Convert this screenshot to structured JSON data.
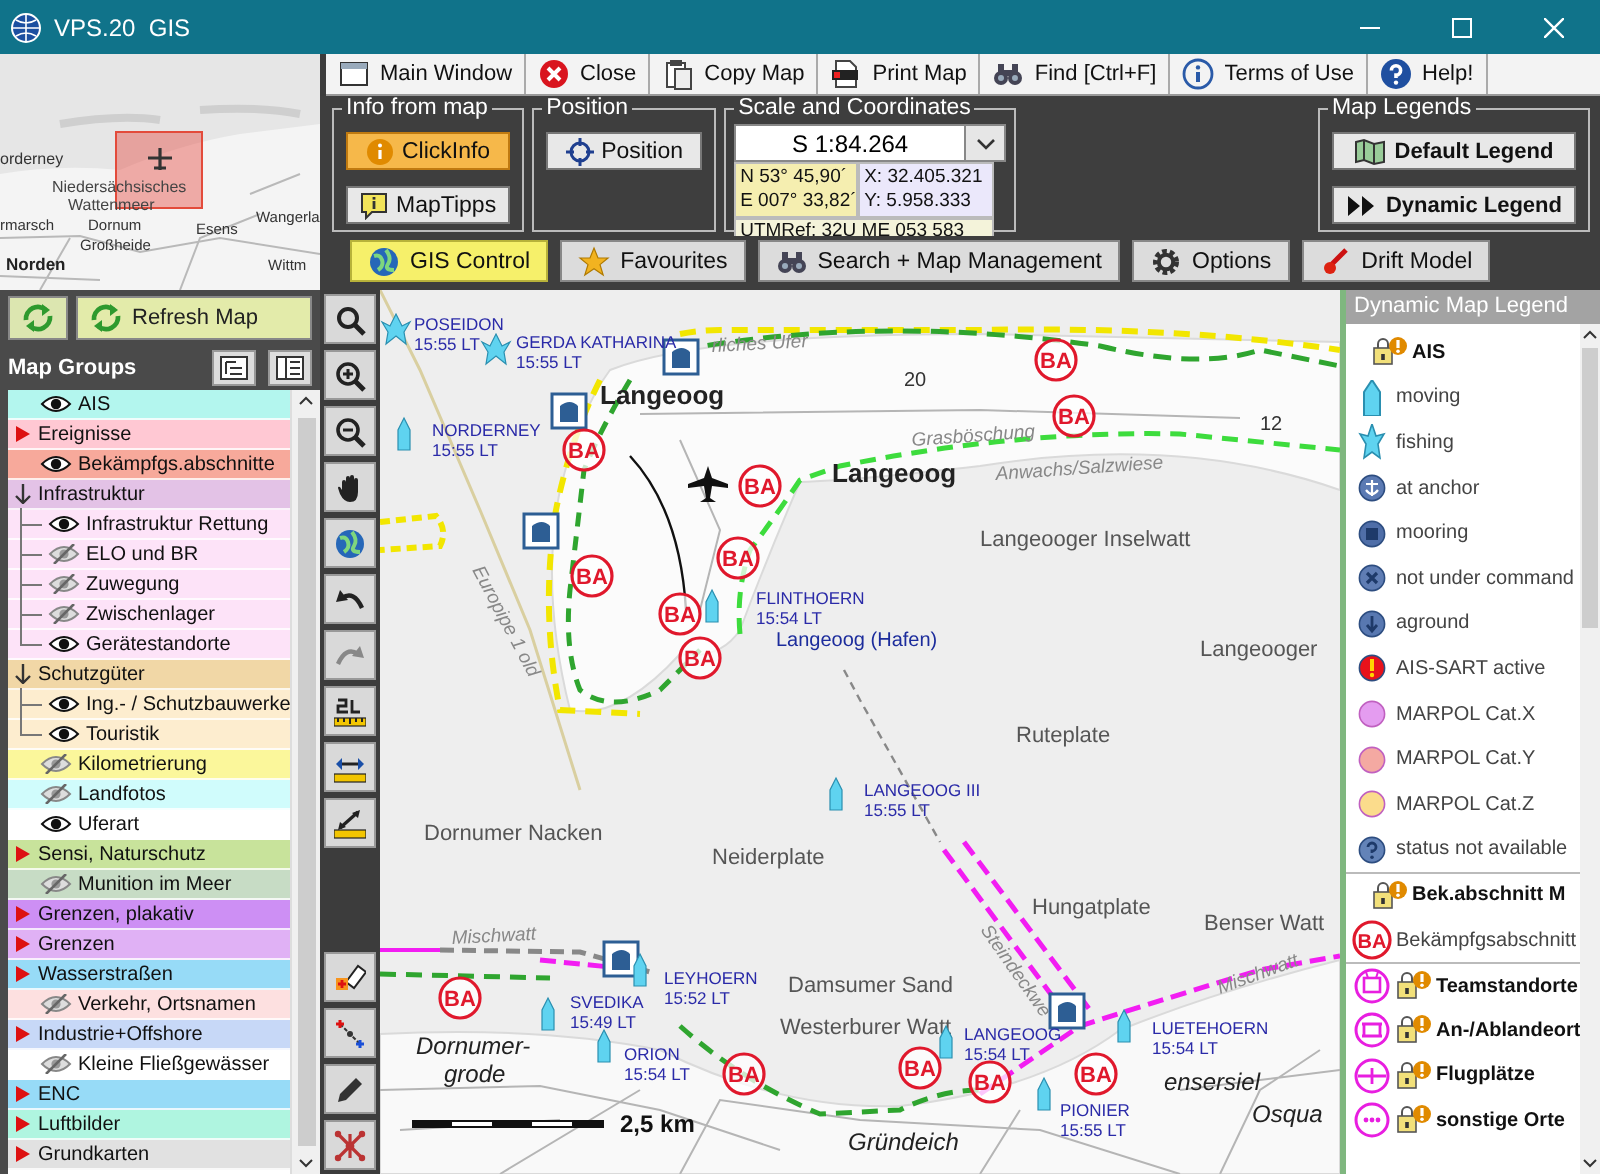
{
  "window": {
    "title": "VPS.20  GIS"
  },
  "minimap": {
    "labels": [
      "orderney",
      "Niedersächsisches",
      "Wattenmeer",
      "rmarsch",
      "Dornum",
      "Esens",
      "Wangerla",
      "Großheide",
      "Norden",
      "Wittm"
    ]
  },
  "toolbar": [
    "Main Window",
    "Close",
    "Copy Map",
    "Print Map",
    "Find [Ctrl+F]",
    "Terms of Use",
    "Help!"
  ],
  "info_from_map": {
    "title": "Info from map",
    "buttons": [
      {
        "label": "ClickInfo",
        "selected": true
      },
      {
        "label": "MapTipps",
        "selected": false
      }
    ]
  },
  "position": {
    "title": "Position",
    "button": "Position"
  },
  "scale_and_coordinates": {
    "title": "Scale and Coordinates",
    "scale": "S 1:84.264",
    "latitude": "N 53° 45,90´",
    "longitude": "E 007° 33,82´",
    "x": "X: 32.405.321",
    "y": "Y: 5.958.333",
    "utm": "UTMRef: 32U ME 053 583"
  },
  "map_legends": {
    "title": "Map Legends",
    "buttons": [
      "Default Legend",
      "Dynamic Legend"
    ]
  },
  "tabs": [
    {
      "label": "GIS Control",
      "selected": true
    },
    {
      "label": "Favourites",
      "selected": false
    },
    {
      "label": "Search + Map Management",
      "selected": false
    },
    {
      "label": "Options",
      "selected": false
    },
    {
      "label": "Drift Model",
      "selected": false
    }
  ],
  "refresh_button": "Refresh Map",
  "map_groups": {
    "title": "Map Groups",
    "items": [
      {
        "kind": "layer",
        "label": "AIS",
        "visible": true,
        "color": "#b3f6ee"
      },
      {
        "kind": "group",
        "label": "Ereignisse",
        "expanded": false,
        "color": "#ffc8d3"
      },
      {
        "kind": "layer",
        "label": "Bekämpfgs.abschnitte",
        "visible": true,
        "color": "#f7a99b"
      },
      {
        "kind": "group",
        "label": "Infrastruktur",
        "expanded": true,
        "color": "#e3c2e6",
        "children": [
          {
            "kind": "layer",
            "label": "Infrastruktur Rettung",
            "visible": true,
            "color": "#fde3f8"
          },
          {
            "kind": "layer",
            "label": "ELO und BR",
            "visible": false,
            "color": "#fde3f8"
          },
          {
            "kind": "layer",
            "label": "Zuwegung",
            "visible": false,
            "color": "#fde3f8"
          },
          {
            "kind": "layer",
            "label": "Zwischenlager",
            "visible": false,
            "color": "#fde3f8"
          },
          {
            "kind": "layer",
            "label": "Gerätestandorte",
            "visible": true,
            "color": "#fde3f8"
          }
        ]
      },
      {
        "kind": "group",
        "label": "Schutzgüter",
        "expanded": true,
        "color": "#f1d7a6",
        "children": [
          {
            "kind": "layer",
            "label": "Ing.- / Schutzbauwerke",
            "visible": true,
            "color": "#fdedcf"
          },
          {
            "kind": "layer",
            "label": "Touristik",
            "visible": true,
            "color": "#fdedcf"
          }
        ]
      },
      {
        "kind": "layer",
        "label": "Kilometrierung",
        "visible": false,
        "color": "#fbf79b"
      },
      {
        "kind": "layer",
        "label": "Landfotos",
        "visible": false,
        "color": "#d0fcfc"
      },
      {
        "kind": "layer",
        "label": "Uferart",
        "visible": true,
        "color": "#ffffff"
      },
      {
        "kind": "group",
        "label": "Sensi, Naturschutz",
        "expanded": false,
        "color": "#c8e39b"
      },
      {
        "kind": "layer",
        "label": "Munition im Meer",
        "visible": false,
        "color": "#c7dcc5"
      },
      {
        "kind": "group",
        "label": "Grenzen, plakativ",
        "expanded": false,
        "color": "#cd8ff4"
      },
      {
        "kind": "group",
        "label": "Grenzen",
        "expanded": false,
        "color": "#e0b1f5"
      },
      {
        "kind": "group",
        "label": "Wasserstraßen",
        "expanded": false,
        "color": "#97dbf7"
      },
      {
        "kind": "layer",
        "label": "Verkehr, Ortsnamen",
        "visible": false,
        "color": "#fde0e0"
      },
      {
        "kind": "group",
        "label": "Industrie+Offshore",
        "expanded": false,
        "color": "#c7d8f7"
      },
      {
        "kind": "layer",
        "label": "Kleine Fließgewässer",
        "visible": false,
        "color": "#ffffff"
      },
      {
        "kind": "group",
        "label": "ENC",
        "expanded": false,
        "color": "#97dbf7"
      },
      {
        "kind": "group",
        "label": "Luftbilder",
        "expanded": false,
        "color": "#aff5e0"
      },
      {
        "kind": "group",
        "label": "Grundkarten",
        "expanded": false,
        "color": "#e1e1e1"
      }
    ]
  },
  "map": {
    "places": [
      {
        "kind": "feature",
        "text": "rliches Ufer"
      },
      {
        "kind": "island",
        "text": "Langeoog"
      },
      {
        "kind": "number",
        "text": "20"
      },
      {
        "kind": "number",
        "text": "12"
      },
      {
        "kind": "feature",
        "text": "Grasböschung"
      },
      {
        "kind": "island",
        "text": "Langeoog"
      },
      {
        "kind": "feature",
        "text": "Anwachs/Salzwiese"
      },
      {
        "kind": "area",
        "text": "Langeooger Inselwatt"
      },
      {
        "kind": "area",
        "text": "Langeooger"
      },
      {
        "kind": "harbor",
        "text": "Langeoog (Hafen)"
      },
      {
        "kind": "feature",
        "text": "Europipe 1 old"
      },
      {
        "kind": "area",
        "text": "Ruteplate"
      },
      {
        "kind": "area",
        "text": "Dornumer Nacken"
      },
      {
        "kind": "area",
        "text": "Neiderplate"
      },
      {
        "kind": "area",
        "text": "Hungatplate"
      },
      {
        "kind": "area",
        "text": "Benser Watt"
      },
      {
        "kind": "feature",
        "text": "Mischwatt"
      },
      {
        "kind": "feature",
        "text": "Mischwatt"
      },
      {
        "kind": "feature",
        "text": "Steindeckwe"
      },
      {
        "kind": "area",
        "text": "Damsumer Sand"
      },
      {
        "kind": "area",
        "text": "Westerburer Watt"
      },
      {
        "kind": "town",
        "text": "Dornumer-"
      },
      {
        "kind": "town",
        "text": "grode"
      },
      {
        "kind": "town",
        "text": "ensersiel"
      },
      {
        "kind": "town",
        "text": "Osqua"
      },
      {
        "kind": "town",
        "text": "Gründeich"
      }
    ],
    "vessels": [
      {
        "kind": "fishing",
        "name": "POSEIDON",
        "time": "15:55 LT"
      },
      {
        "kind": "fishing",
        "name": "GERDA KATHARINA",
        "time": "15:55 LT"
      },
      {
        "kind": "moving",
        "name": "NORDERNEY",
        "time": "15:55 LT"
      },
      {
        "kind": "moving",
        "name": "FLINTHOERN",
        "time": "15:54 LT"
      },
      {
        "kind": "moving",
        "name": "LANGEOOG III",
        "time": "15:55 LT"
      },
      {
        "kind": "moving",
        "name": "SVEDIKA",
        "time": "15:49 LT"
      },
      {
        "kind": "moving",
        "name": "LEYHOERN",
        "time": "15:52 LT"
      },
      {
        "kind": "moving",
        "name": "ORION",
        "time": "15:54 LT"
      },
      {
        "kind": "moving",
        "name": "LANGEOOG",
        "time": "15:54 LT"
      },
      {
        "kind": "moving",
        "name": "LUETEHOERN",
        "time": "15:54 LT"
      },
      {
        "kind": "moving",
        "name": "PIONIER",
        "time": "15:55 LT"
      }
    ],
    "markers": [
      "BA",
      "BA",
      "BA",
      "BA",
      "BA",
      "BA",
      "BA",
      "BA",
      "BA",
      "BA",
      "BA",
      "BA",
      "BA"
    ],
    "scale_label": "2,5 km"
  },
  "legend": {
    "title": "Dynamic Map Legend",
    "items": [
      {
        "kind": "header",
        "label": "AIS"
      },
      {
        "kind": "vessel",
        "label": "moving"
      },
      {
        "kind": "fishing-vessel",
        "label": "fishing"
      },
      {
        "kind": "status",
        "label": "at anchor",
        "color": "#5b7ab3"
      },
      {
        "kind": "status",
        "label": "mooring",
        "color": "#4f6ea8"
      },
      {
        "kind": "status",
        "label": "not under command",
        "color": "#5f7db4"
      },
      {
        "kind": "status",
        "label": "aground",
        "color": "#5878b1"
      },
      {
        "kind": "status",
        "label": "AIS-SART active",
        "color": "#e8121b"
      },
      {
        "kind": "status",
        "label": "MARPOL Cat.X",
        "color": "#e49cf0"
      },
      {
        "kind": "status",
        "label": "MARPOL Cat.Y",
        "color": "#f4a9a2"
      },
      {
        "kind": "status",
        "label": "MARPOL Cat.Z",
        "color": "#fbdc8c"
      },
      {
        "kind": "status",
        "label": "status not available",
        "color": "#6383b8"
      },
      {
        "kind": "header",
        "label": "Bek.abschnitt M"
      },
      {
        "kind": "ba-marker",
        "label": "Bekämpfgsabschnitt",
        "badge": "BA"
      },
      {
        "kind": "site",
        "label": "Teamstandorte"
      },
      {
        "kind": "site",
        "label": "An-/Ablandeort"
      },
      {
        "kind": "site",
        "label": "Flugplätze"
      },
      {
        "kind": "site",
        "label": "sonstige Orte"
      }
    ]
  }
}
